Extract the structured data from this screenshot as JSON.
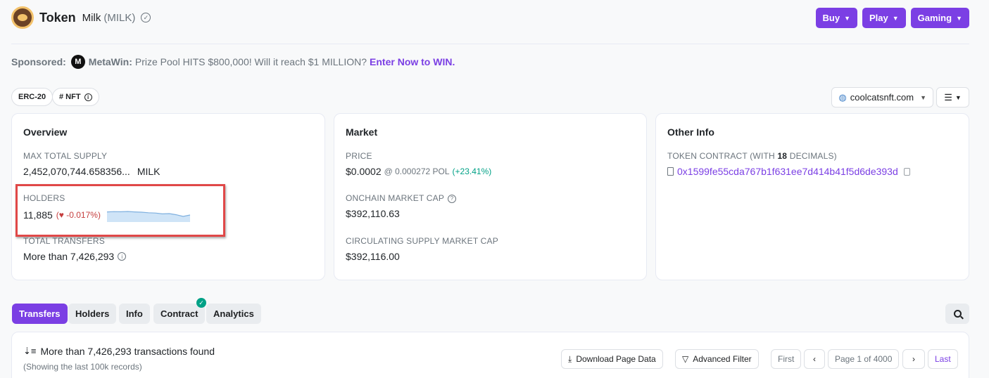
{
  "header": {
    "title": "Token",
    "token_name": "Milk",
    "token_symbol": "(MILK)"
  },
  "top_buttons": [
    {
      "label": "Buy"
    },
    {
      "label": "Play"
    },
    {
      "label": "Gaming"
    }
  ],
  "sponsored": {
    "label": "Sponsored:",
    "sponsor_name": "MetaWin:",
    "text": "Prize Pool HITS $800,000! Will it reach $1 MILLION?",
    "link": "Enter Now to WIN."
  },
  "chips": {
    "erc20": "ERC-20",
    "nft": "# NFT",
    "website": "coolcatsnft.com"
  },
  "overview": {
    "title": "Overview",
    "max_supply_label": "MAX TOTAL SUPPLY",
    "max_supply_value": "2,452,070,744.658356...",
    "max_supply_unit": "MILK",
    "holders_label": "HOLDERS",
    "holders_value": "11,885",
    "holders_change": "-0.017%)",
    "holders_sparkline": [
      0.72,
      0.74,
      0.73,
      0.75,
      0.72,
      0.7,
      0.66,
      0.64,
      0.58,
      0.6,
      0.52,
      0.4,
      0.5
    ],
    "transfers_label": "TOTAL TRANSFERS",
    "transfers_value": "More than 7,426,293"
  },
  "market": {
    "title": "Market",
    "price_label": "PRICE",
    "price_value": "$0.0002",
    "price_pol": "@ 0.000272 POL",
    "price_change": "(+23.41%)",
    "mcap_label": "ONCHAIN MARKET CAP",
    "mcap_value": "$392,110.63",
    "circ_label": "CIRCULATING SUPPLY MARKET CAP",
    "circ_value": "$392,116.00"
  },
  "other_info": {
    "title": "Other Info",
    "contract_label_pre": "TOKEN CONTRACT (WITH",
    "contract_decimals": "18",
    "contract_label_post": "DECIMALS)",
    "contract_address": "0x1599fe55cda767b1f631ee7d414b41f5d6de393d"
  },
  "tabs": [
    {
      "label": "Transfers",
      "active": true
    },
    {
      "label": "Holders"
    },
    {
      "label": "Info"
    },
    {
      "label": "Contract"
    },
    {
      "label": "Analytics"
    }
  ],
  "transactions": {
    "count_text": "More than 7,426,293 transactions found",
    "sub_text": "(Showing the last 100k records)",
    "download_label": "Download Page Data",
    "filter_label": "Advanced Filter",
    "first_label": "First",
    "page_label": "Page 1 of 4000",
    "last_label": "Last"
  },
  "colors": {
    "accent": "#7b3fe4",
    "positive": "#00a186",
    "negative": "#c53d3d",
    "highlight_box": "#e04848"
  }
}
